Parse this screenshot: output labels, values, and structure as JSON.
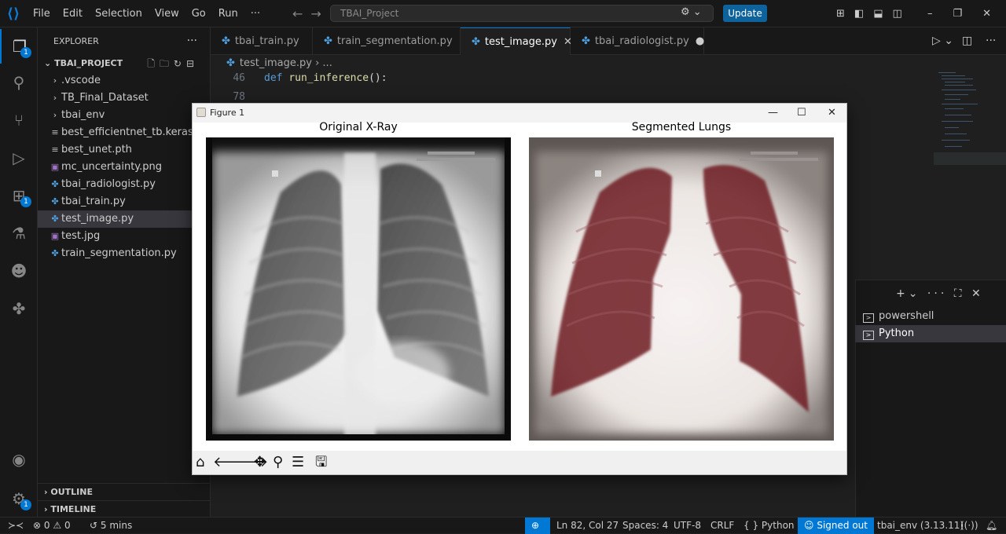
{
  "titlebar": {
    "menu": [
      "File",
      "Edit",
      "Selection",
      "View",
      "Go",
      "Run",
      "···"
    ],
    "search": "TBAI_Project",
    "update_label": "Update"
  },
  "explorer": {
    "header": "EXPLORER",
    "project": "TBAI_PROJECT",
    "items": [
      {
        "label": ".vscode",
        "kind": "folder"
      },
      {
        "label": "TB_Final_Dataset",
        "kind": "folder"
      },
      {
        "label": "tbai_env",
        "kind": "folder"
      },
      {
        "label": "best_efficientnet_tb.keras",
        "kind": "file"
      },
      {
        "label": "best_unet.pth",
        "kind": "file"
      },
      {
        "label": "mc_uncertainty.png",
        "kind": "image"
      },
      {
        "label": "tbai_radiologist.py",
        "kind": "python"
      },
      {
        "label": "tbai_train.py",
        "kind": "python"
      },
      {
        "label": "test_image.py",
        "kind": "python",
        "selected": true
      },
      {
        "label": "test.jpg",
        "kind": "image"
      },
      {
        "label": "train_segmentation.py",
        "kind": "python"
      }
    ],
    "outline": "OUTLINE",
    "timeline": "TIMELINE"
  },
  "badges": {
    "explorer": "1",
    "extensions": "1",
    "settings": "1"
  },
  "tabs": [
    {
      "label": "tbai_train.py"
    },
    {
      "label": "train_segmentation.py"
    },
    {
      "label": "test_image.py",
      "active": true
    },
    {
      "label": "tbai_radiologist.py",
      "dirty": true
    }
  ],
  "breadcrumb": {
    "file": "test_image.py",
    "rest": "› ..."
  },
  "code": {
    "lines": [
      {
        "num": "46",
        "kw": "def",
        "fn": "run_inference",
        "rest": "():"
      },
      {
        "num": "78",
        "kw": "",
        "fn": "",
        "rest": ""
      }
    ]
  },
  "terminal": {
    "items": [
      "powershell",
      "Python"
    ]
  },
  "figure": {
    "window_title": "Figure 1",
    "left_title": "Original X-Ray",
    "right_title": "Segmented Lungs"
  },
  "statusbar": {
    "problems": "0",
    "warnings": "0",
    "time": "5 mins",
    "position": "Ln 82, Col 27",
    "spaces": "Spaces: 4",
    "encoding": "UTF-8",
    "eol": "CRLF",
    "language": "Python",
    "account": "Signed out",
    "env": "tbai_env (3.13.11)"
  },
  "colors": {
    "accent": "#0078d4",
    "lung_mask": "#6e1a22"
  }
}
